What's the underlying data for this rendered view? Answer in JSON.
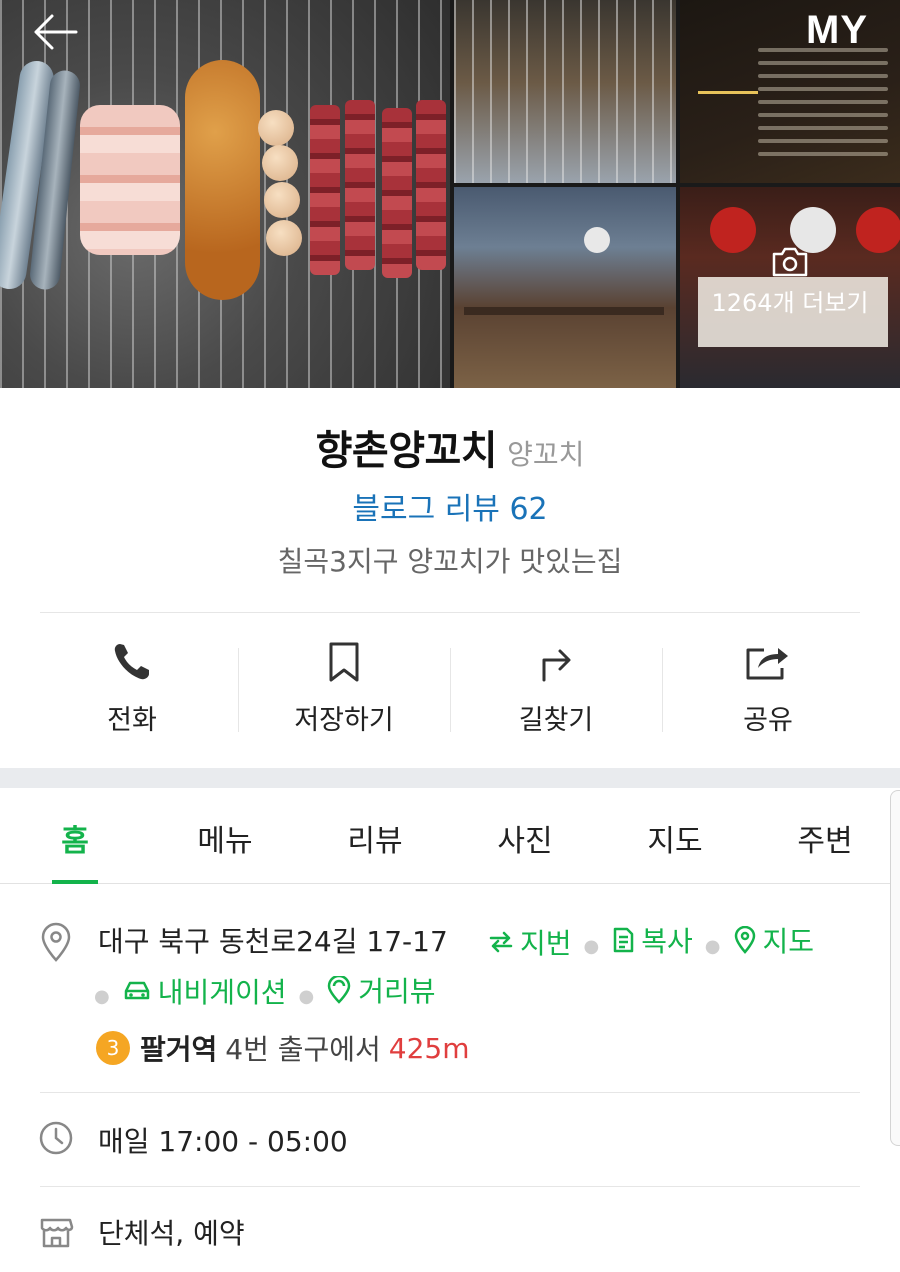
{
  "header": {
    "back_icon": "back-arrow-icon",
    "my_label": "MY",
    "photo_count_label": "1264개 더보기"
  },
  "place": {
    "name": "향촌양꼬치",
    "category": "양꼬치",
    "blog_review": "블로그 리뷰 62",
    "tagline": "칠곡3지구 양꼬치가 맛있는집"
  },
  "actions": [
    {
      "label": "전화",
      "icon": "phone-icon"
    },
    {
      "label": "저장하기",
      "icon": "bookmark-icon"
    },
    {
      "label": "길찾기",
      "icon": "directions-icon"
    },
    {
      "label": "공유",
      "icon": "share-icon"
    }
  ],
  "tabs": [
    {
      "label": "홈",
      "active": true
    },
    {
      "label": "메뉴"
    },
    {
      "label": "리뷰"
    },
    {
      "label": "사진"
    },
    {
      "label": "지도"
    },
    {
      "label": "주변"
    }
  ],
  "address": {
    "text": "대구 북구 동천로24길 17-17",
    "links": [
      "지번",
      "복사",
      "지도",
      "내비게이션",
      "거리뷰"
    ]
  },
  "subway": {
    "line": "3",
    "line_color": "#f5a623",
    "station": "팔거역",
    "exit": "4번 출구에서",
    "distance": "425m"
  },
  "hours": "매일 17:00 - 05:00",
  "facilities": "단체석, 예약",
  "colors": {
    "accent": "#13b34b",
    "link_blue": "#1a73b8",
    "distance_red": "#e03e3e"
  }
}
